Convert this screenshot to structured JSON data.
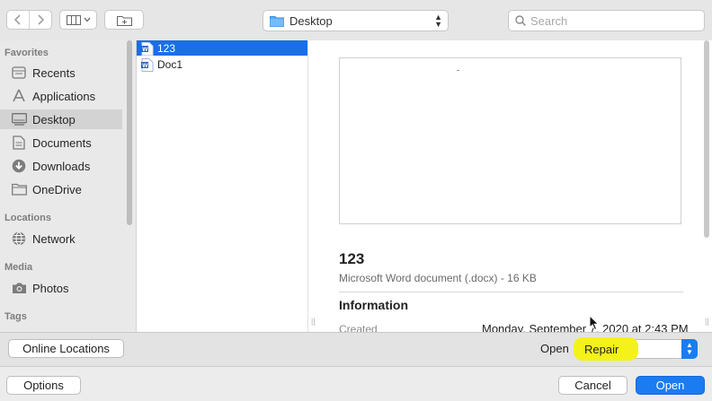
{
  "toolbar": {
    "location": "Desktop",
    "search_placeholder": "Search"
  },
  "sidebar": {
    "sections": [
      {
        "title": "Favorites"
      },
      {
        "title": "Locations"
      },
      {
        "title": "Media"
      },
      {
        "title": "Tags"
      }
    ],
    "items": [
      {
        "label": "Recents",
        "icon": "clock-icon"
      },
      {
        "label": "Applications",
        "icon": "applications-icon"
      },
      {
        "label": "Desktop",
        "icon": "desktop-icon",
        "selected": true
      },
      {
        "label": "Documents",
        "icon": "document-icon"
      },
      {
        "label": "Downloads",
        "icon": "download-icon"
      },
      {
        "label": "OneDrive",
        "icon": "folder-icon"
      },
      {
        "label": "Network",
        "icon": "network-icon"
      },
      {
        "label": "Photos",
        "icon": "camera-icon"
      }
    ]
  },
  "files": [
    {
      "name": "123",
      "selected": true
    },
    {
      "name": "Doc1",
      "selected": false
    }
  ],
  "preview": {
    "name": "123",
    "kind": "Microsoft Word document (.docx) - 16 KB",
    "info_heading": "Information",
    "created_label": "Created",
    "created_value": "Monday, September 7, 2020 at 2:43 PM"
  },
  "bottom": {
    "online_locations": "Online Locations",
    "open_label": "Open",
    "open_mode": "Repair",
    "options": "Options",
    "cancel": "Cancel",
    "open_button": "Open"
  },
  "colors": {
    "accent": "#1b7cf2",
    "selection": "#1a6ee6",
    "highlight": "#f4f21a"
  }
}
